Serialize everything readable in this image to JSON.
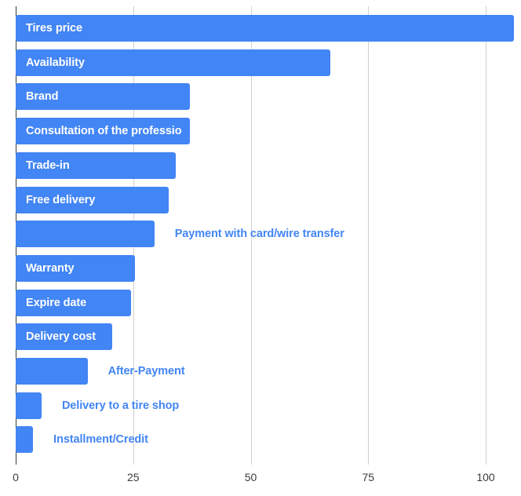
{
  "chart_data": {
    "type": "bar",
    "orientation": "horizontal",
    "title": "",
    "subtitle": "",
    "xlabel": "",
    "ylabel": "",
    "xlim": [
      0,
      107
    ],
    "x_ticks": [
      0,
      25,
      50,
      75,
      100
    ],
    "x_tick_labels": [
      "0",
      "25",
      "50",
      "75",
      "100"
    ],
    "grid": "vertical",
    "legend": "none",
    "bar_color": "#4285f4",
    "inside_label_color": "#ffffff",
    "outside_label_color": "#4285f4",
    "axis_color": "#3c3c3c",
    "gridline_color": "#d0d0d0",
    "categories": [
      "Tires price",
      "Availability",
      "Brand",
      "Consultation of the professional",
      "Trade-in",
      "Free delivery",
      "Payment with card/wire transfer",
      "Warranty",
      "Expire date",
      "Delivery cost",
      "After-Payment",
      "Delivery to a tire shop",
      "Installment/Credit"
    ],
    "values": [
      106,
      67,
      37,
      37,
      34,
      32.5,
      29.5,
      25.3,
      24.5,
      20.5,
      15.3,
      5.5,
      3.7
    ],
    "label_placement": [
      "inside",
      "inside",
      "inside",
      "inside",
      "inside",
      "inside",
      "outside",
      "inside",
      "inside",
      "inside",
      "outside",
      "outside",
      "outside"
    ],
    "displayed_labels": [
      "Tires price",
      "Availability",
      "Brand",
      "Consultation of the professio",
      "Trade-in",
      "Free delivery",
      "Payment with card/wire transfer",
      "Warranty",
      "Expire date",
      "Delivery cost",
      "After-Payment",
      "Delivery to a tire shop",
      "Installment/Credit"
    ]
  }
}
